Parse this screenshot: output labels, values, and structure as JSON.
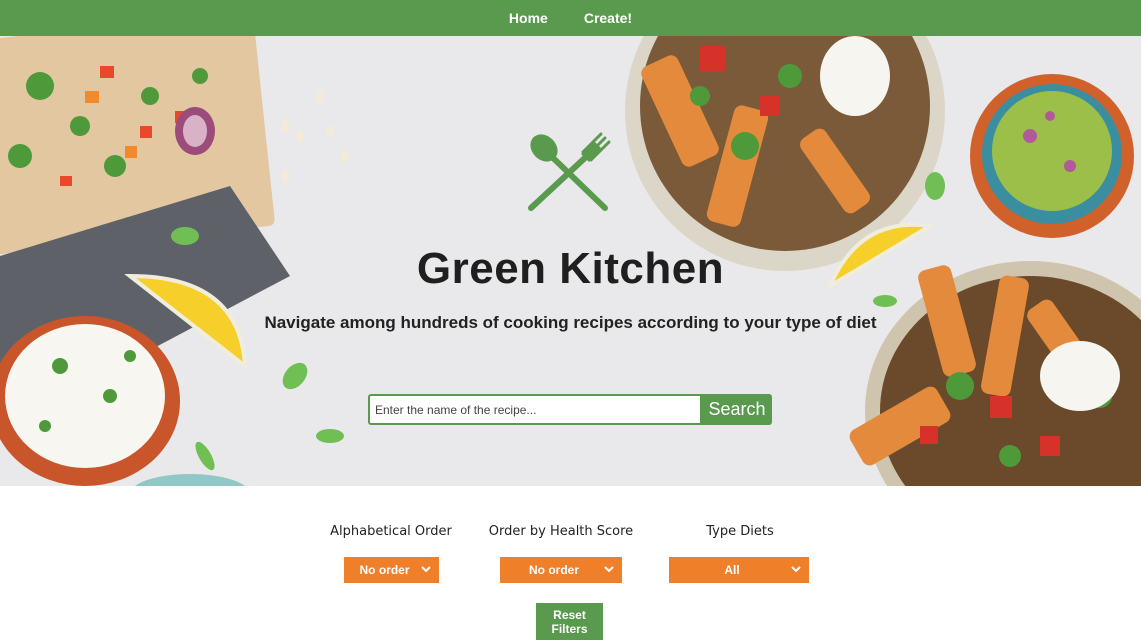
{
  "nav": {
    "home": "Home",
    "create": "Create!"
  },
  "hero": {
    "logo_icon": "spoon-fork-crossed-icon",
    "title": "Green Kitchen",
    "subtitle": "Navigate among hundreds of cooking recipes according to your type of diet"
  },
  "search": {
    "placeholder": "Enter the name of the recipe...",
    "value": "",
    "button_label": "Search"
  },
  "filters": {
    "alphabetical": {
      "label": "Alphabetical Order",
      "selected": "No order"
    },
    "health_score": {
      "label": "Order by Health Score",
      "selected": "No order"
    },
    "type_diets": {
      "label": "Type Diets",
      "selected": "All"
    }
  },
  "reset": {
    "label": "Reset Filters"
  },
  "colors": {
    "brand_green": "#5a9a4e",
    "accent_orange": "#f07f2a"
  }
}
